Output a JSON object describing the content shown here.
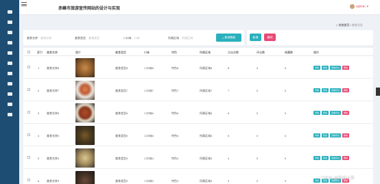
{
  "app": {
    "title": "赤峰市旅游宣传网站的设计与实现"
  },
  "user": {
    "name": "admin"
  },
  "breadcrumb": {
    "home": "系统首页",
    "current": "美食信息"
  },
  "sidebar": {
    "items": [
      "home-icon",
      "users-icon",
      "card-icon",
      "tag-icon",
      "chart-icon",
      "list-icon",
      "grid-icon",
      "table-icon",
      "person-icon",
      "folder-icon",
      "message-icon"
    ]
  },
  "search": {
    "fields": [
      {
        "label": "美食名称",
        "placeholder": "美食名称"
      },
      {
        "label": "美食类型",
        "placeholder": "美食类型"
      },
      {
        "label": "口味",
        "placeholder": "口味"
      },
      {
        "label": "所属区域",
        "placeholder": "所属区域"
      }
    ],
    "button": "查询数据"
  },
  "actions": {
    "add": "新增",
    "delete": "删除"
  },
  "table": {
    "columns": [
      "索引",
      "美食名称",
      "图片",
      "美食类型",
      "口味",
      "特色",
      "所属区域",
      "点击次数",
      "评论数",
      "收藏数",
      "操作"
    ],
    "rows": [
      {
        "index": "1",
        "name": "美食名称8",
        "type": "美食类型8",
        "taste": "口味8",
        "feature": "特色8",
        "region": "所属区域8",
        "clicks": "8",
        "comments": "0",
        "favorites": "0"
      },
      {
        "index": "2",
        "name": "美食名称7",
        "type": "美食类型7",
        "taste": "口味7",
        "feature": "特色7",
        "region": "所属区域7",
        "clicks": "7",
        "comments": "0",
        "favorites": "0"
      },
      {
        "index": "3",
        "name": "美食名称6",
        "type": "美食类型6",
        "taste": "口味6",
        "feature": "特色6",
        "region": "所属区域6",
        "clicks": "6",
        "comments": "0",
        "favorites": "0"
      },
      {
        "index": "4",
        "name": "美食名称5",
        "type": "美食类型5",
        "taste": "口味5",
        "feature": "特色5",
        "region": "所属区域5",
        "clicks": "5",
        "comments": "0",
        "favorites": "0"
      },
      {
        "index": "5",
        "name": "美食名称4",
        "type": "美食类型4",
        "taste": "口味4",
        "feature": "特色4",
        "region": "所属区域4",
        "clicks": "4",
        "comments": "0",
        "favorites": "0"
      },
      {
        "index": "6",
        "name": "美食名称3",
        "type": "美食类型3",
        "taste": "口味3",
        "feature": "特色3",
        "region": "所属区域3",
        "clicks": "3",
        "comments": "0",
        "favorites": "0"
      }
    ],
    "row_actions": [
      "详情",
      "修改",
      "查看评论",
      "删除"
    ]
  },
  "colors": {
    "sidebar": "#1e4d73",
    "primary": "#2ab0bd",
    "danger": "#e84a74",
    "user": "#e05a6b"
  },
  "watermark": "CSDN @码农小苗"
}
